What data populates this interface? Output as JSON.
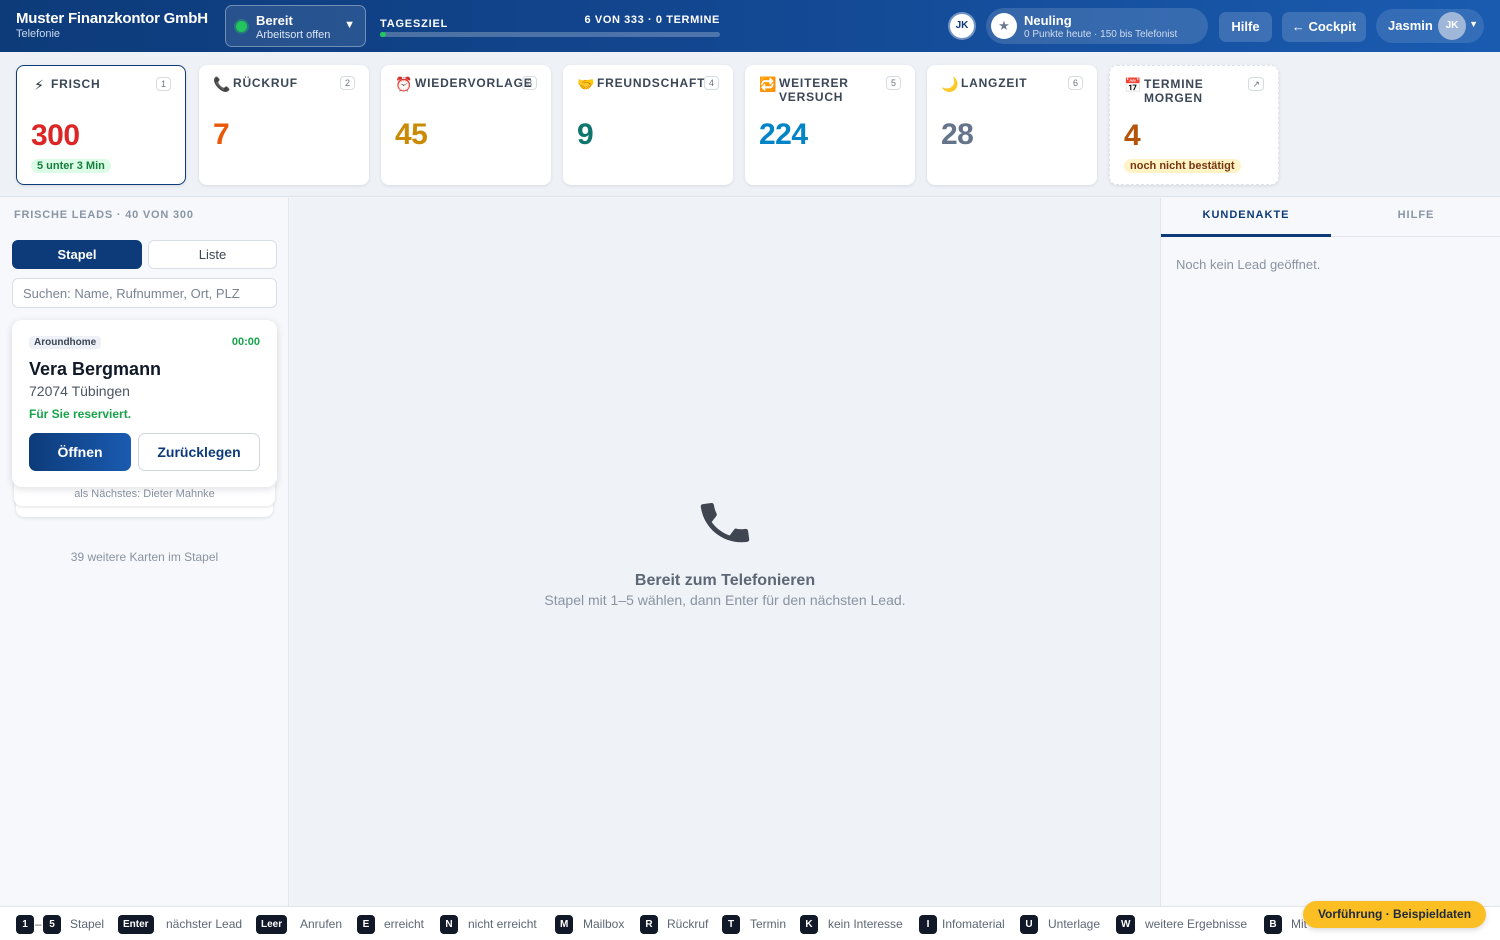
{
  "header": {
    "company": "Muster Finanzkontor GmbH",
    "module": "Telefonie",
    "status": {
      "label": "Bereit",
      "sub": "Arbeitsort offen",
      "color": "#22c55e"
    },
    "goal": {
      "label": "TAGESZIEL",
      "value": "6 VON 333 · 0 TERMINE",
      "progress": 0.018
    },
    "avatar_initials": "JK",
    "rank": {
      "title": "Neuling",
      "sub": "0 Punkte heute · 150 bis Telefonist",
      "icon": "star-icon"
    },
    "help_label": "Hilfe",
    "cockpit_label": "← Cockpit",
    "user": {
      "name": "Jasmin",
      "initials": "JK"
    }
  },
  "cards": [
    {
      "icon": "⚡",
      "icon_name": "lightning-icon",
      "title": "FRISCH",
      "key": "1",
      "value": "300",
      "color": "#dc2626",
      "badge": "5 unter 3 Min",
      "badge_bg": "#dcfce7",
      "badge_color": "#15803d"
    },
    {
      "icon": "📞",
      "icon_name": "phone-icon",
      "title": "RÜCKRUF",
      "key": "2",
      "value": "7",
      "color": "#ea580c"
    },
    {
      "icon": "⏰",
      "icon_name": "alarm-clock-icon",
      "title": "WIEDERVORLAGE",
      "key": "3",
      "value": "45",
      "color": "#ca8a04"
    },
    {
      "icon": "🤝",
      "icon_name": "handshake-icon",
      "title": "FREUNDSCHAFT",
      "key": "4",
      "value": "9",
      "color": "#0f766e"
    },
    {
      "icon": "🔁",
      "icon_name": "repeat-icon",
      "title": "WEITERER VERSUCH",
      "key": "5",
      "value": "224",
      "color": "#0284c7"
    },
    {
      "icon": "🌙",
      "icon_name": "moon-icon",
      "title": "LANGZEIT",
      "key": "6",
      "value": "28",
      "color": "#64748b"
    },
    {
      "icon": "📅",
      "icon_name": "calendar-icon",
      "title": "TERMINE MORGEN",
      "key": "↗",
      "value": "4",
      "color": "#b45309",
      "badge": "noch nicht bestätigt",
      "badge_bg": "#fef3c7",
      "badge_color": "#78350f"
    }
  ],
  "left": {
    "heading": "FRISCHE LEADS · 40 VON 300",
    "tabs": {
      "stack": "Stapel",
      "list": "Liste"
    },
    "search_placeholder": "Suchen: Name, Rufnummer, Ort, PLZ",
    "lead": {
      "source": "Aroundhome",
      "timer": "00:00",
      "name": "Vera Bergmann",
      "location": "72074 Tübingen",
      "reserved": "Für Sie reserviert.",
      "open_label": "Öffnen",
      "back_label": "Zurücklegen"
    },
    "next": "als Nächstes: Dieter Mahnke",
    "more": "39 weitere Karten im Stapel"
  },
  "center": {
    "icon": "📞",
    "title": "Bereit zum Telefonieren",
    "subtitle": "Stapel mit 1–5 wählen, dann Enter für den nächsten Lead."
  },
  "right": {
    "tabs": [
      "KUNDENAKTE",
      "HILFE"
    ],
    "empty": "Noch kein Lead geöffnet."
  },
  "footer": {
    "shortcuts": [
      {
        "key": "1",
        "label": ""
      },
      {
        "key": "5",
        "label": "Stapel"
      },
      {
        "key": "Enter",
        "label": "nächster Lead"
      },
      {
        "key": "Leer",
        "label": "Anrufen"
      },
      {
        "key": "E",
        "label": "erreicht"
      },
      {
        "key": "N",
        "label": "nicht erreicht"
      },
      {
        "key": "M",
        "label": "Mailbox"
      },
      {
        "key": "R",
        "label": "Rückruf"
      },
      {
        "key": "T",
        "label": "Termin"
      },
      {
        "key": "K",
        "label": "kein Interesse"
      },
      {
        "key": "I",
        "label": "Infomaterial"
      },
      {
        "key": "U",
        "label": "Unterlage"
      },
      {
        "key": "W",
        "label": "weitere Ergebnisse"
      },
      {
        "key": "B",
        "label": "Mit"
      }
    ],
    "range_sep": "–"
  },
  "demo_badge": "Vorführung · Beispieldaten"
}
